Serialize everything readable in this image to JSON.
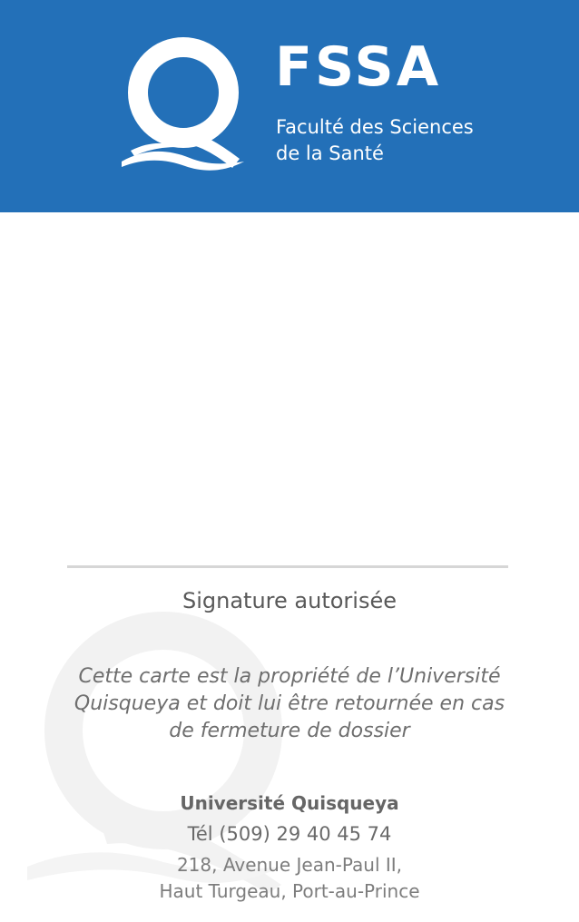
{
  "header": {
    "brand": "FSSA",
    "subtitle_line1": "Faculté des Sciences",
    "subtitle_line2": "de la Santé",
    "logo_icon": "q-wave-logo-icon",
    "color": "#2370b8"
  },
  "signature": {
    "label": "Signature autorisée"
  },
  "notice": {
    "line1": "Cette carte est la propriété de l’Université",
    "line2": "Quisqueya et doit lui être retournée en cas",
    "line3": "de fermeture de dossier"
  },
  "footer": {
    "university": "Université  Quisqueya",
    "phone": "Tél (509) 29 40 45 74",
    "address_line1": "218, Avenue Jean-Paul II,",
    "address_line2": "Haut Turgeau, Port-au-Prince"
  },
  "watermark_icon": "q-watermark-icon"
}
